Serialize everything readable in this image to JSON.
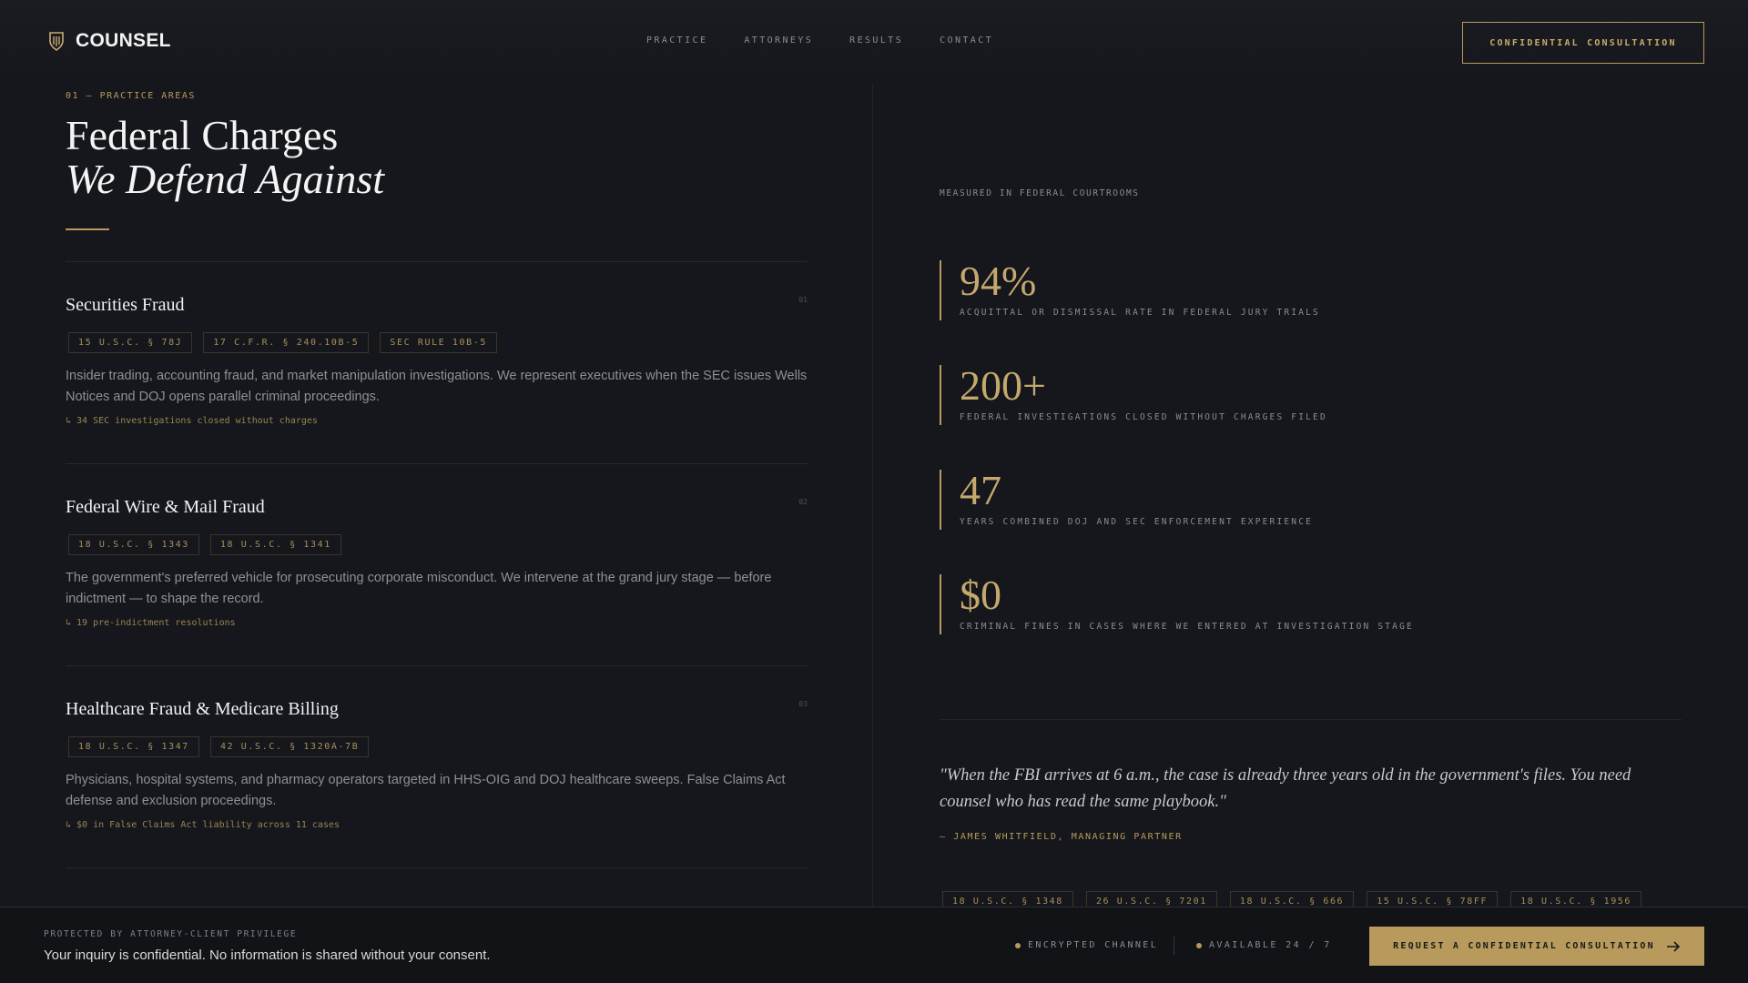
{
  "header": {
    "logo_text": "COUNSEL",
    "nav": [
      "PRACTICE",
      "ATTORNEYS",
      "RESULTS",
      "CONTACT"
    ],
    "cta": "CONFIDENTIAL CONSULTATION"
  },
  "left": {
    "section_label": "01 — PRACTICE AREAS",
    "headline_line1": "Federal Charges",
    "headline_line2": "We Defend Against",
    "practices": [
      {
        "title": "Securities Fraud",
        "num": "01",
        "tags": [
          "15 U.S.C. § 78J",
          "17 C.F.R. § 240.10B-5",
          "SEC RULE 10B-5"
        ],
        "desc": "Insider trading, accounting fraud, and market manipulation investigations. We represent executives when the SEC issues Wells Notices and DOJ opens parallel criminal proceedings.",
        "note": "↳ 34 SEC investigations closed without charges"
      },
      {
        "title": "Federal Wire & Mail Fraud",
        "num": "02",
        "tags": [
          "18 U.S.C. § 1343",
          "18 U.S.C. § 1341"
        ],
        "desc": "The government's preferred vehicle for prosecuting corporate misconduct. We intervene at the grand jury stage — before indictment — to shape the record.",
        "note": "↳ 19 pre-indictment resolutions"
      },
      {
        "title": "Healthcare Fraud & Medicare Billing",
        "num": "03",
        "tags": [
          "18 U.S.C. § 1347",
          "42 U.S.C. § 1320A-7B"
        ],
        "desc": "Physicians, hospital systems, and pharmacy operators targeted in HHS-OIG and DOJ healthcare sweeps. False Claims Act defense and exclusion proceedings.",
        "note": "↳ $0 in False Claims Act liability across 11 cases"
      }
    ]
  },
  "right": {
    "measured": "MEASURED IN FEDERAL COURTROOMS",
    "stats": [
      {
        "value": "94%",
        "label": "ACQUITTAL OR DISMISSAL RATE IN FEDERAL JURY TRIALS"
      },
      {
        "value": "200+",
        "label": "FEDERAL INVESTIGATIONS CLOSED WITHOUT CHARGES FILED"
      },
      {
        "value": "47",
        "label": "YEARS COMBINED DOJ AND SEC ENFORCEMENT EXPERIENCE"
      },
      {
        "value": "$0",
        "label": "CRIMINAL FINES IN CASES WHERE WE ENTERED AT INVESTIGATION STAGE"
      }
    ],
    "quote": "\"When the FBI arrives at 6 a.m., the case is already three years old in the government's files. You need counsel who has read the same playbook.\"",
    "quote_attr": "— JAMES WHITFIELD, MANAGING PARTNER",
    "tags": [
      "18 U.S.C. § 1348",
      "26 U.S.C. § 7201",
      "18 U.S.C. § 666",
      "15 U.S.C. § 78FF",
      "18 U.S.C. § 1956"
    ]
  },
  "footer": {
    "label": "PROTECTED BY ATTORNEY-CLIENT PRIVILEGE",
    "text": "Your inquiry is confidential. No information is shared without your consent.",
    "status1": "ENCRYPTED CHANNEL",
    "status2": "AVAILABLE 24 / 7",
    "cta": "REQUEST A CONFIDENTIAL CONSULTATION"
  },
  "colors": {
    "accent": "#b89a5c",
    "background": "#15171c"
  },
  "icons": {
    "logo": "shield-icon",
    "cta_arrow": "arrow-right-icon"
  }
}
